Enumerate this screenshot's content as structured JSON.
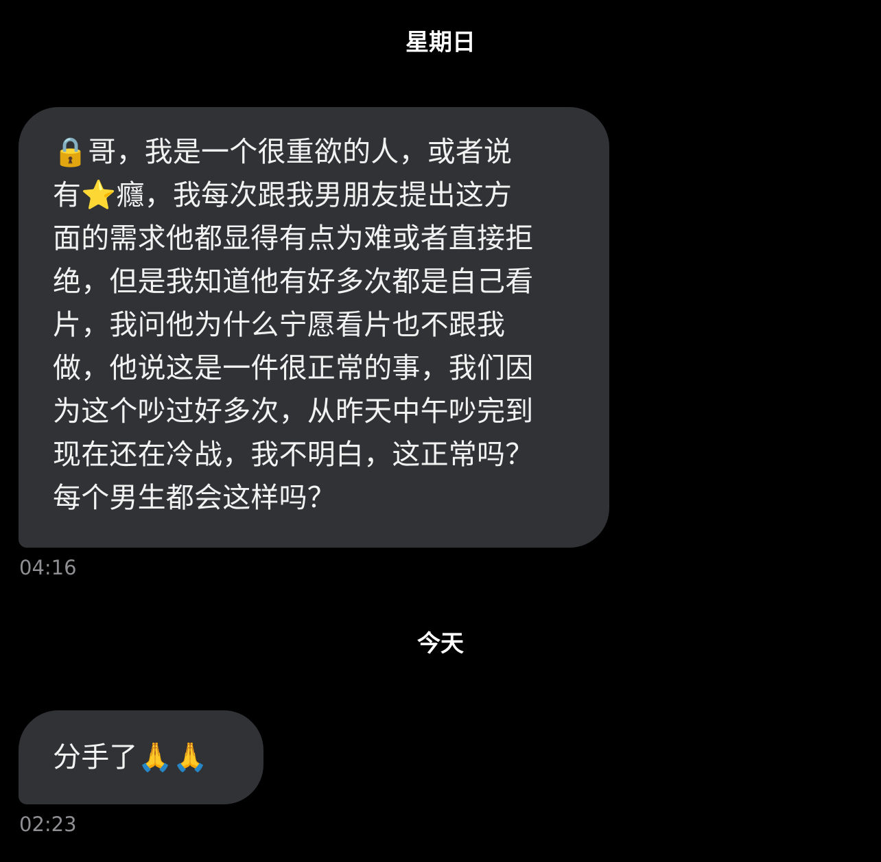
{
  "conversation": {
    "separators": {
      "sunday": "星期日",
      "today": "今天"
    },
    "messages": [
      {
        "text": "🔒哥，我是一个很重欲的人，或者说\n有⭐癮，我每次跟我男朋友提出这方\n面的需求他都显得有点为难或者直接拒\n绝，但是我知道他有好多次都是自己看\n片，我问他为什么宁愿看片也不跟我\n做，他说这是一件很正常的事，我们因\n为这个吵过好多次，从昨天中午吵完到\n现在还在冷战，我不明白，这正常吗？\n每个男生都会这样吗？",
        "time": "04:16"
      },
      {
        "text": "分手了🙏🙏",
        "time": "02:23"
      }
    ]
  },
  "colors": {
    "background": "#000000",
    "bubble": "#313236",
    "timestamp": "#8e8e93"
  }
}
